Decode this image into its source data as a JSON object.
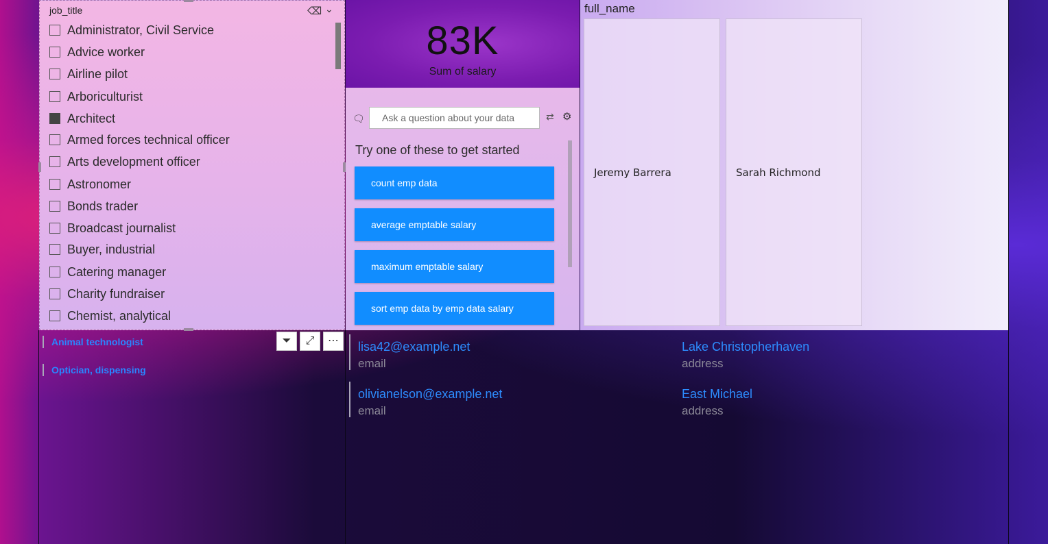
{
  "slicer": {
    "title": "job_title",
    "items": [
      {
        "label": "Administrator, Civil Service",
        "checked": false
      },
      {
        "label": "Advice worker",
        "checked": false
      },
      {
        "label": "Airline pilot",
        "checked": false
      },
      {
        "label": "Arboriculturist",
        "checked": false
      },
      {
        "label": "Architect",
        "checked": true
      },
      {
        "label": "Armed forces technical officer",
        "checked": false
      },
      {
        "label": "Arts development officer",
        "checked": false
      },
      {
        "label": "Astronomer",
        "checked": false
      },
      {
        "label": "Bonds trader",
        "checked": false
      },
      {
        "label": "Broadcast journalist",
        "checked": false
      },
      {
        "label": "Buyer, industrial",
        "checked": false
      },
      {
        "label": "Catering manager",
        "checked": false
      },
      {
        "label": "Charity fundraiser",
        "checked": false
      },
      {
        "label": "Chemist, analytical",
        "checked": false
      }
    ]
  },
  "kpi": {
    "value": "83K",
    "caption": "Sum of salary"
  },
  "qa": {
    "placeholder": "Ask a question about your data",
    "try_text": "Try one of these to get started",
    "suggestions": [
      "count emp data",
      "average emptable salary",
      "maximum emptable salary",
      "sort emp data by emp data salary"
    ]
  },
  "names": {
    "title": "full_name",
    "cards": [
      "Jeremy Barrera",
      "Sarah Richmond"
    ]
  },
  "job_list": [
    "Animal technologist",
    "Optician, dispensing"
  ],
  "contacts": [
    {
      "email": "lisa42@example.net",
      "email_caption": "email",
      "address": "Lake Christopherhaven",
      "address_caption": "address"
    },
    {
      "email": "olivianelson@example.net",
      "email_caption": "email",
      "address": "East Michael",
      "address_caption": "address"
    }
  ],
  "colors": {
    "accent": "#118dff",
    "link": "#2d8dff"
  }
}
